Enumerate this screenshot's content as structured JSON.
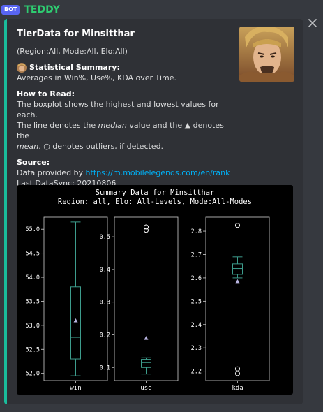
{
  "header": {
    "bot_tag": "BOT",
    "author": "TEDDY"
  },
  "embed": {
    "title": "TierData for Minsitthar",
    "filters": "(Region:All, Mode:All, Elo:All)",
    "summary": {
      "name": "Statistical Summary:",
      "value": "Averages in Win%, Use%, KDA over Time."
    },
    "how_to_read": {
      "name": "How to Read:",
      "line1": "The boxplot shows the highest and lowest values for each.",
      "line2a": "The line denotes the ",
      "median_word": "median",
      "line2b": " value and the ▲ denotes the",
      "mean_word": "mean",
      "line3": ". ○ denotes outliers, if detected."
    },
    "source": {
      "name": "Source:",
      "prefix": "Data provided by ",
      "link_text": "https://m.mobilelegends.com/en/rank",
      "last_sync": "Last DataSync: 20210806"
    },
    "accent_color": "#1abc9c"
  },
  "chart_data": {
    "type": "boxplot",
    "title": "Summary Data for Minsitthar",
    "subtitle": "Region: all, Elo: All-Levels, Mode:All-Modes",
    "box_color": "#3d9c8c",
    "mean_color": "#b8b4e0",
    "panels": [
      {
        "label": "win",
        "ylim": [
          51.85,
          55.25
        ],
        "ticks": [
          52.0,
          52.5,
          53.0,
          53.5,
          54.0,
          54.5,
          55.0
        ],
        "tick_labels": [
          "52.0",
          "52.5",
          "53.0",
          "53.5",
          "54.0",
          "54.5",
          "55.0"
        ],
        "min": 51.95,
        "q1": 52.3,
        "median": 52.75,
        "q3": 53.8,
        "max": 55.15,
        "mean": 53.1,
        "outliers": []
      },
      {
        "label": "use",
        "ylim": [
          0.06,
          0.56
        ],
        "ticks": [
          0.1,
          0.2,
          0.3,
          0.4,
          0.5
        ],
        "tick_labels": [
          "0.1",
          "0.2",
          "0.3",
          "0.4",
          "0.5"
        ],
        "min": 0.08,
        "q1": 0.1,
        "median": 0.115,
        "q3": 0.125,
        "max": 0.13,
        "mean": 0.19,
        "outliers": [
          0.52,
          0.53
        ]
      },
      {
        "label": "kda",
        "ylim": [
          2.16,
          2.86
        ],
        "ticks": [
          2.2,
          2.3,
          2.4,
          2.5,
          2.6,
          2.7,
          2.8
        ],
        "tick_labels": [
          "2.2",
          "2.3",
          "2.4",
          "2.5",
          "2.6",
          "2.7",
          "2.8"
        ],
        "min": 2.6,
        "q1": 2.615,
        "median": 2.64,
        "q3": 2.66,
        "max": 2.69,
        "mean": 2.585,
        "outliers": [
          2.19,
          2.21,
          2.825
        ]
      }
    ]
  }
}
